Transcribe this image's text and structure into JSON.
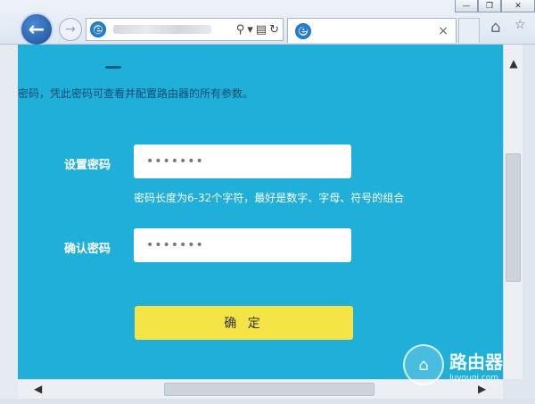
{
  "browser": {
    "tab_close": "×",
    "window_buttons": [
      "—",
      "❐",
      "✕"
    ]
  },
  "page": {
    "intro_text": "密码，凭此密码可查看并配置路由器的所有参数。",
    "set_password_label": "设置密码",
    "set_password_value": "•••••••",
    "hint_text": "密码长度为6-32个字符，最好是数字、字母、符号的组合",
    "confirm_password_label": "确认密码",
    "confirm_password_value": "•••••••",
    "confirm_button": "确 定"
  },
  "watermark": {
    "title": "路由器",
    "subtitle": "luyouqi.com"
  },
  "colors": {
    "content_bg": "#20afd8",
    "button_yellow": "#f5e446",
    "back_button": "#1d4f95"
  }
}
